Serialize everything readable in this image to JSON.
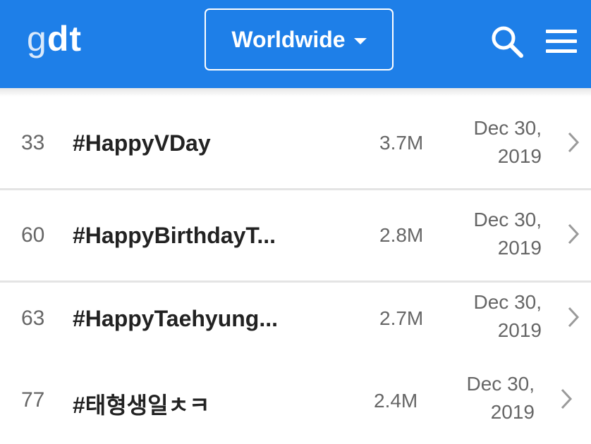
{
  "header": {
    "logo_light": "g",
    "logo_bold": "dt",
    "region_label": "Worldwide",
    "search_icon": "search-icon",
    "menu_icon": "hamburger-menu-icon",
    "accent_color": "#1e7fe8"
  },
  "trends": [
    {
      "rank": "33",
      "hashtag": "#HappyVDay",
      "volume": "3.7M",
      "date_line1": "Dec 30,",
      "date_line2": "2019"
    },
    {
      "rank": "60",
      "hashtag": "#HappyBirthdayT...",
      "volume": "2.8M",
      "date_line1": "Dec 30,",
      "date_line2": "2019"
    },
    {
      "rank": "63",
      "hashtag": "#HappyTaehyung...",
      "volume": "2.7M",
      "date_line1": "Dec 30,",
      "date_line2": "2019"
    },
    {
      "rank": "77",
      "hashtag": "#태형생일ㅊㅋ",
      "volume": "2.4M",
      "date_line1": "Dec 30,",
      "date_line2": "2019"
    }
  ]
}
